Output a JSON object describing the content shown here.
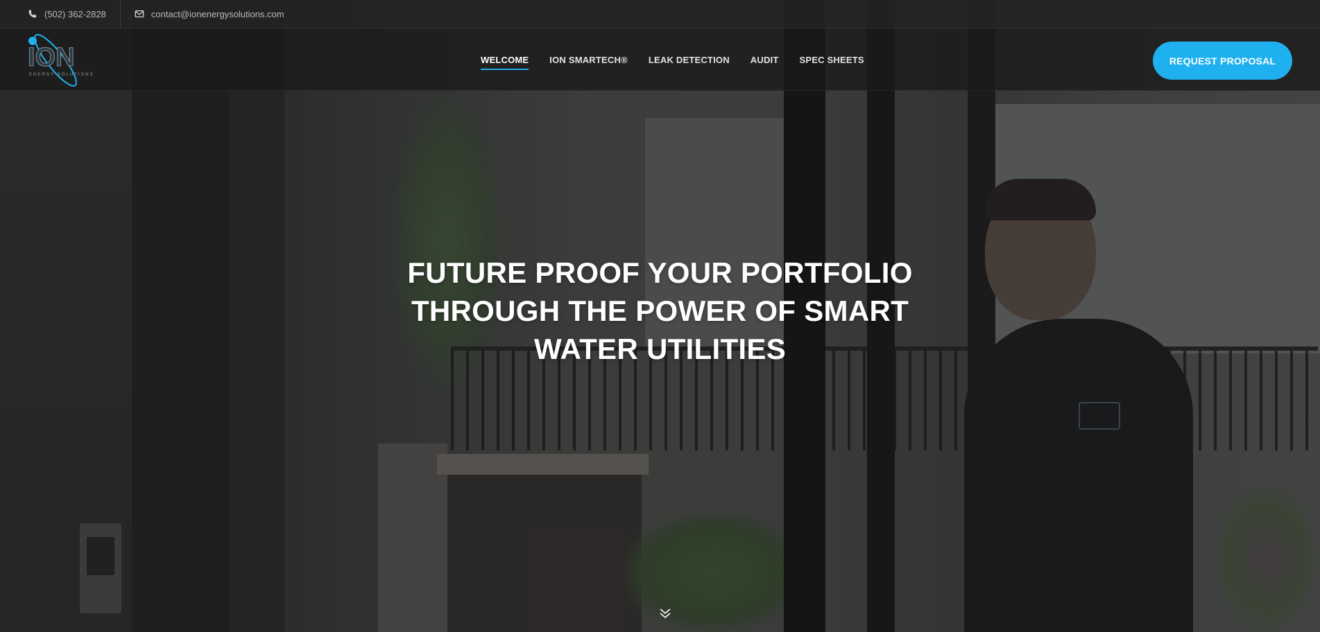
{
  "topbar": {
    "phone": "(502) 362-2828",
    "email": "contact@ionenergysolutions.com",
    "phone_icon": "phone-icon",
    "email_icon": "envelope-icon"
  },
  "header": {
    "logo_text": "ION",
    "logo_subtext": "ENERGY SOLUTIONS",
    "nav": [
      {
        "label": "WELCOME",
        "active": true
      },
      {
        "label": "ION SMARTECH®",
        "active": false
      },
      {
        "label": "LEAK DETECTION",
        "active": false
      },
      {
        "label": "AUDIT",
        "active": false
      },
      {
        "label": "SPEC SHEETS",
        "active": false
      }
    ],
    "cta_label": "REQUEST PROPOSAL"
  },
  "hero": {
    "headline_lines": [
      "FUTURE PROOF YOUR PORTFOLIO",
      "THROUGH THE POWER OF SMART",
      "WATER UTILITIES"
    ],
    "scroll_icon": "double-chevron-down-icon"
  },
  "colors": {
    "accent": "#1fb1ef",
    "topbar_bg": "#222324",
    "header_bg": "#19191a",
    "text": "#ffffff"
  }
}
